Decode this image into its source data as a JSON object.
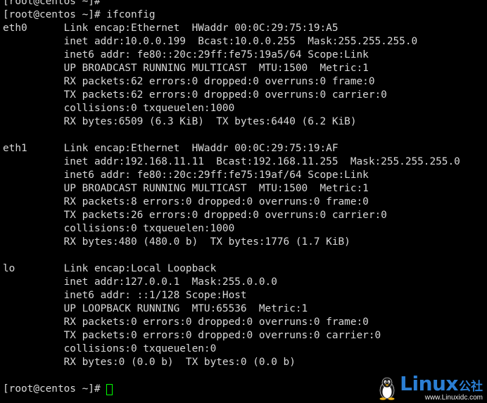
{
  "terminal": {
    "lines": [
      "[root@centos ~]#",
      "[root@centos ~]# ifconfig",
      "eth0      Link encap:Ethernet  HWaddr 00:0C:29:75:19:A5",
      "          inet addr:10.0.0.199  Bcast:10.0.0.255  Mask:255.255.255.0",
      "          inet6 addr: fe80::20c:29ff:fe75:19a5/64 Scope:Link",
      "          UP BROADCAST RUNNING MULTICAST  MTU:1500  Metric:1",
      "          RX packets:62 errors:0 dropped:0 overruns:0 frame:0",
      "          TX packets:62 errors:0 dropped:0 overruns:0 carrier:0",
      "          collisions:0 txqueuelen:1000",
      "          RX bytes:6509 (6.3 KiB)  TX bytes:6440 (6.2 KiB)",
      "",
      "eth1      Link encap:Ethernet  HWaddr 00:0C:29:75:19:AF",
      "          inet addr:192.168.11.11  Bcast:192.168.11.255  Mask:255.255.255.0",
      "          inet6 addr: fe80::20c:29ff:fe75:19af/64 Scope:Link",
      "          UP BROADCAST RUNNING MULTICAST  MTU:1500  Metric:1",
      "          RX packets:8 errors:0 dropped:0 overruns:0 frame:0",
      "          TX packets:26 errors:0 dropped:0 overruns:0 carrier:0",
      "          collisions:0 txqueuelen:1000",
      "          RX bytes:480 (480.0 b)  TX bytes:1776 (1.7 KiB)",
      "",
      "lo        Link encap:Local Loopback",
      "          inet addr:127.0.0.1  Mask:255.0.0.0",
      "          inet6 addr: ::1/128 Scope:Host",
      "          UP LOOPBACK RUNNING  MTU:65536  Metric:1",
      "          RX packets:0 errors:0 dropped:0 overruns:0 frame:0",
      "          TX packets:0 errors:0 dropped:0 overruns:0 carrier:0",
      "          collisions:0 txqueuelen:0",
      "          RX bytes:0 (0.0 b)  TX bytes:0 (0.0 b)",
      ""
    ],
    "prompt": "[root@centos ~]# ",
    "colors": {
      "background": "#000000",
      "text": "#d8d8d8",
      "cursor": "#00ff00"
    }
  },
  "watermark": {
    "brand": "Linux",
    "brand_cn": "公社",
    "url": "www.Linuxidc.com",
    "icon": "tux-penguin-icon",
    "color": "#2b7fd4"
  }
}
